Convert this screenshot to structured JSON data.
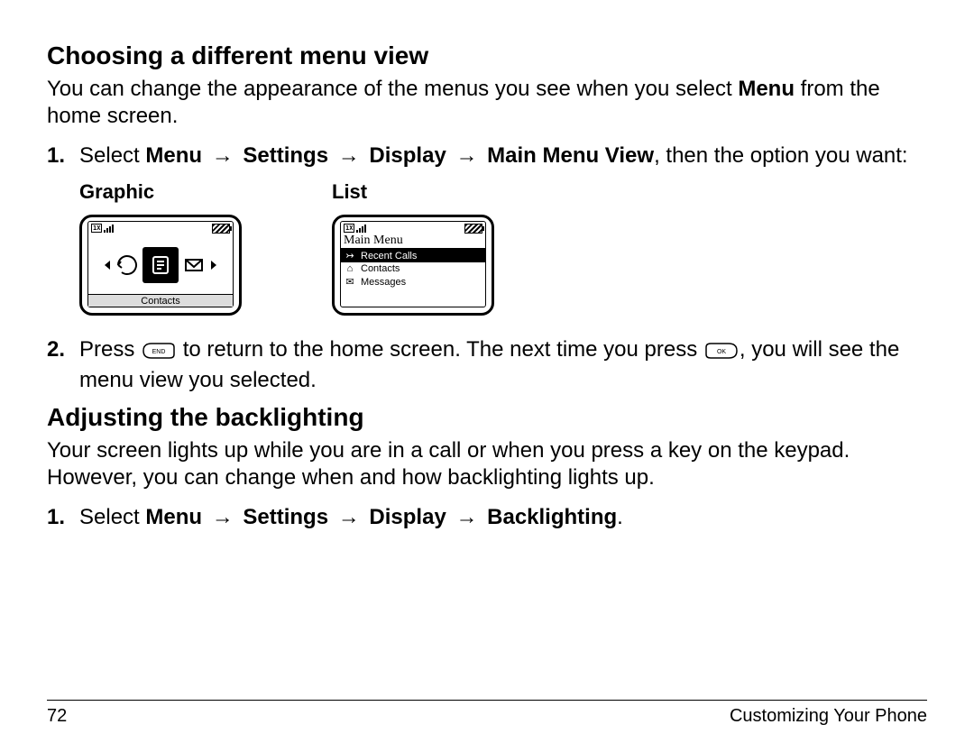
{
  "sections": {
    "menu_view": {
      "heading": "Choosing a different menu view",
      "intro_pre": "You can change the appearance of the menus you see when you select ",
      "intro_bold": "Menu",
      "intro_post": " from the home screen.",
      "step1_num": "1.",
      "step1_pre": "Select ",
      "step1_path": [
        "Menu",
        "Settings",
        "Display",
        "Main Menu View"
      ],
      "step1_post": ", then the option you want:",
      "options": {
        "graphic_label": "Graphic",
        "list_label": "List"
      },
      "list_screen": {
        "title": "Main Menu",
        "items": [
          {
            "icon": "↣",
            "label": "Recent Calls",
            "selected": true
          },
          {
            "icon": "⌂",
            "label": "Contacts",
            "selected": false
          },
          {
            "icon": "✉",
            "label": "Messages",
            "selected": false
          }
        ]
      },
      "graphic_screen": {
        "soft_label": "Contacts"
      },
      "step2_num": "2.",
      "step2_a": "Press ",
      "step2_b": " to return to the home screen. The next time you press ",
      "step2_c": ", you will see the menu view you selected."
    },
    "backlight": {
      "heading": "Adjusting the backlighting",
      "intro": "Your screen lights up while you are in a call or when you press a key on the keypad. However, you can change when and how backlighting lights up.",
      "step1_num": "1.",
      "step1_pre": "Select ",
      "step1_path": [
        "Menu",
        "Settings",
        "Display",
        "Backlighting"
      ],
      "step1_post": "."
    }
  },
  "glyphs": {
    "arrow": "→"
  },
  "footer": {
    "page": "72",
    "chapter": "Customizing Your Phone"
  }
}
